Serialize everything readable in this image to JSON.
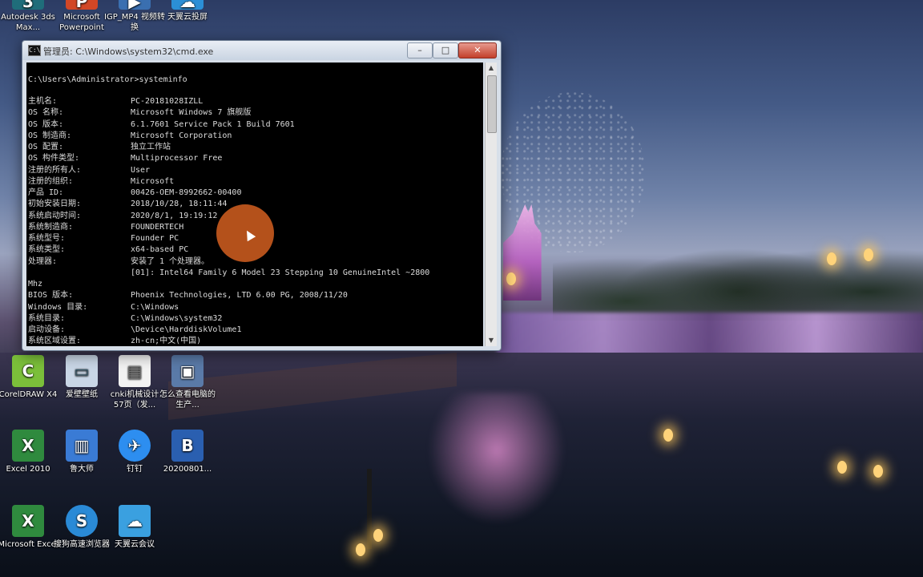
{
  "desktop_icons": [
    {
      "label": "Autodesk 3ds Max...",
      "icon": "3dsmax-icon",
      "color": "#1f6d7a"
    },
    {
      "label": "Microsoft Powerpoint",
      "icon": "powerpoint-icon",
      "color": "#d24726"
    },
    {
      "label": "IGP_MP4 视频转换",
      "icon": "video-converter-icon",
      "color": "#3a6fb0"
    },
    {
      "label": "天翼云投屏",
      "icon": "cloud-cast-icon",
      "color": "#2b8fd6"
    },
    {
      "label": "CorelDRAW X4",
      "icon": "coreldraw-icon",
      "color": "#7bbf3a"
    },
    {
      "label": "爱壁壁纸",
      "icon": "wallpaper-icon",
      "color": "#c9d6e6"
    },
    {
      "label": "cnki机械设计 57页（发...",
      "icon": "document-icon",
      "color": "#f2f2f2"
    },
    {
      "label": "怎么查看电脑的生产...",
      "icon": "screenshot-icon",
      "color": "#5a7aa8"
    },
    {
      "label": "Excel 2010",
      "icon": "excel-icon",
      "color": "#2f8a3e"
    },
    {
      "label": "鲁大师",
      "icon": "computer-icon",
      "color": "#3a7bd5"
    },
    {
      "label": "钉钉",
      "icon": "dingtalk-icon",
      "color": "#2d8ef0"
    },
    {
      "label": "20200801...",
      "icon": "word-doc-icon",
      "color": "#2a5fb0"
    },
    {
      "label": "Microsoft Excel",
      "icon": "excel-icon",
      "color": "#2f8a3e"
    },
    {
      "label": "搜狗高速浏览器",
      "icon": "sogou-browser-icon",
      "color": "#2a8ad6"
    },
    {
      "label": "天翼云会议",
      "icon": "cloud-meeting-icon",
      "color": "#3aa0e0"
    }
  ],
  "window": {
    "title": "管理员: C:\\Windows\\system32\\cmd.exe",
    "console_icon_glyph": "C:\\",
    "minimize_glyph": "–",
    "maximize_glyph": "□",
    "close_glyph": "✕"
  },
  "console": {
    "prompt": "C:\\Users\\Administrator>systeminfo",
    "rows": [
      {
        "key": "主机名:",
        "value": "PC-20181028IZLL"
      },
      {
        "key": "OS 名称:",
        "value": "Microsoft Windows 7 旗舰版"
      },
      {
        "key": "OS 版本:",
        "value": "6.1.7601 Service Pack 1 Build 7601"
      },
      {
        "key": "OS 制造商:",
        "value": "Microsoft Corporation"
      },
      {
        "key": "OS 配置:",
        "value": "独立工作站"
      },
      {
        "key": "OS 构件类型:",
        "value": "Multiprocessor Free"
      },
      {
        "key": "注册的所有人:",
        "value": "User"
      },
      {
        "key": "注册的组织:",
        "value": "Microsoft"
      },
      {
        "key": "产品 ID:",
        "value": "00426-OEM-8992662-00400"
      },
      {
        "key": "初始安装日期:",
        "value": "2018/10/28, 18:11:44"
      },
      {
        "key": "系统启动时间:",
        "value": "2020/8/1, 19:19:12"
      },
      {
        "key": "系统制造商:",
        "value": "FOUNDERTECH"
      },
      {
        "key": "系统型号:",
        "value": "Founder PC"
      },
      {
        "key": "系统类型:",
        "value": "x64-based PC"
      },
      {
        "key": "处理器:",
        "value": "安装了 1 个处理器。"
      },
      {
        "key": "",
        "value": "[01]: Intel64 Family 6 Model 23 Stepping 10 GenuineIntel ~2800"
      },
      {
        "key": " Mhz",
        "value": ""
      },
      {
        "key": "BIOS 版本:",
        "value": "Phoenix Technologies, LTD 6.00 PG, 2008/11/20"
      },
      {
        "key": "Windows 目录:",
        "value": "C:\\Windows"
      },
      {
        "key": "系统目录:",
        "value": "C:\\Windows\\system32"
      },
      {
        "key": "启动设备:",
        "value": "\\Device\\HarddiskVolume1"
      },
      {
        "key": "系统区域设置:",
        "value": "zh-cn;中文(中国)"
      }
    ]
  },
  "colors": {
    "console_bg": "#000000",
    "console_text": "#dcdcdc",
    "cursor_highlight": "#c85a1e"
  }
}
